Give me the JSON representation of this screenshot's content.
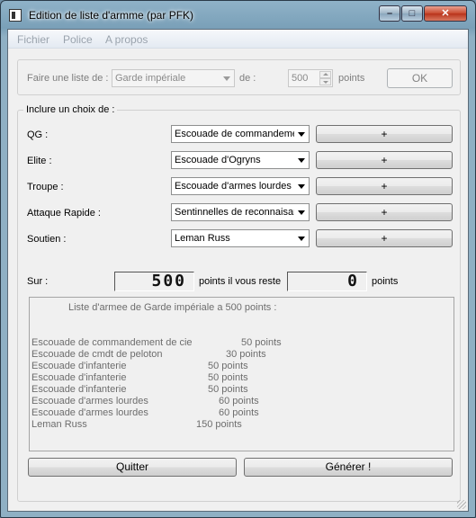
{
  "window": {
    "title": "Edition de liste d'armme (par PFK)",
    "min_glyph": "–",
    "max_glyph": "□",
    "close_glyph": "✕"
  },
  "menu": [
    "Fichier",
    "Police",
    "A propos"
  ],
  "top_row": {
    "label_prefix": "Faire une liste de :",
    "army": "Garde impériale",
    "label_de": "de :",
    "points_value": "500",
    "label_points": "points",
    "ok_label": "OK"
  },
  "choices": {
    "group_title": "Inclure un choix de :",
    "add_label": "+",
    "rows": [
      {
        "label": "QG :",
        "value": "Escouade de commandement"
      },
      {
        "label": "Elite :",
        "value": "Escouade d'Ogryns"
      },
      {
        "label": "Troupe :",
        "value": "Escouade d'armes lourdes"
      },
      {
        "label": "Attaque Rapide :",
        "value": "Sentinnelles de reconnaisance"
      },
      {
        "label": "Soutien :",
        "value": "Leman Russ"
      }
    ],
    "sur_label": "Sur :",
    "total": "500",
    "remaining_label": "points il vous reste",
    "remaining": "0",
    "points_label": "points"
  },
  "result": {
    "header": "Liste d'armee de Garde impériale a 500 points :",
    "lines": [
      {
        "name": "Escouade de commandement de cie",
        "points": "50 points"
      },
      {
        "name": "Escouade de cmdt de peloton",
        "points": "30 points"
      },
      {
        "name": "Escouade d'infanterie",
        "points": "50 points"
      },
      {
        "name": "Escouade d'infanterie",
        "points": "50 points"
      },
      {
        "name": "Escouade d'infanterie",
        "points": "50 points"
      },
      {
        "name": "Escouade d'armes lourdes",
        "points": "60 points"
      },
      {
        "name": "Escouade d'armes lourdes",
        "points": "60 points"
      },
      {
        "name": "Leman Russ",
        "points": "150 points"
      }
    ]
  },
  "buttons": {
    "quit": "Quitter",
    "generate": "Générer !"
  }
}
